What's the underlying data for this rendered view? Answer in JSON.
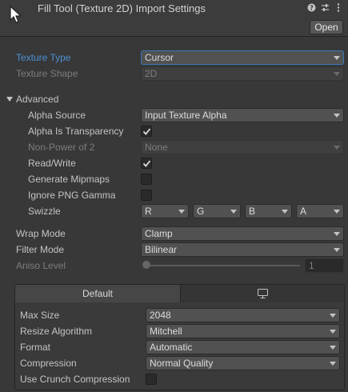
{
  "header": {
    "title": "Fill Tool (Texture 2D) Import Settings",
    "open_label": "Open",
    "icons": [
      "cursor-icon",
      "help-icon",
      "sliders-icon",
      "kebab-menu-icon"
    ]
  },
  "texture_type": {
    "label": "Texture Type",
    "value": "Cursor"
  },
  "texture_shape": {
    "label": "Texture Shape",
    "value": "2D"
  },
  "advanced": {
    "label": "Advanced",
    "alpha_source": {
      "label": "Alpha Source",
      "value": "Input Texture Alpha"
    },
    "alpha_is_transparency": {
      "label": "Alpha Is Transparency",
      "checked": true
    },
    "non_power_of_2": {
      "label": "Non-Power of 2",
      "value": "None"
    },
    "read_write": {
      "label": "Read/Write",
      "checked": true
    },
    "generate_mipmaps": {
      "label": "Generate Mipmaps",
      "checked": false
    },
    "ignore_png_gamma": {
      "label": "Ignore PNG Gamma",
      "checked": false
    },
    "swizzle": {
      "label": "Swizzle",
      "r": "R",
      "g": "G",
      "b": "B",
      "a": "A"
    }
  },
  "wrap_mode": {
    "label": "Wrap Mode",
    "value": "Clamp"
  },
  "filter_mode": {
    "label": "Filter Mode",
    "value": "Bilinear"
  },
  "aniso_level": {
    "label": "Aniso Level",
    "value": "1"
  },
  "platform": {
    "tab_default": "Default",
    "tab_standalone_icon": "monitor-icon",
    "max_size": {
      "label": "Max Size",
      "value": "2048"
    },
    "resize_algorithm": {
      "label": "Resize Algorithm",
      "value": "Mitchell"
    },
    "format": {
      "label": "Format",
      "value": "Automatic"
    },
    "compression": {
      "label": "Compression",
      "value": "Normal Quality"
    },
    "use_crunch": {
      "label": "Use Crunch Compression",
      "checked": false
    }
  },
  "colors": {
    "accent": "#4c91d6",
    "background": "#383838",
    "field": "#515151"
  }
}
